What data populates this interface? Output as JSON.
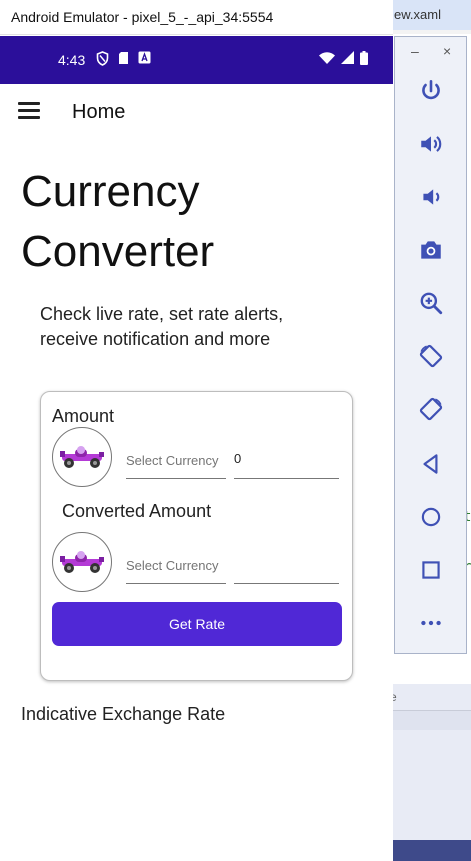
{
  "background": {
    "editor_tab_title": "ew.xaml",
    "lower_pane_char": "e"
  },
  "emulator": {
    "window_title": "Android Emulator - pixel_5_-_api_34:5554",
    "status_bar": {
      "time": "4:43"
    },
    "app_bar": {
      "title": "Home",
      "menu_icon": "hamburger-menu-icon"
    },
    "header": {
      "line1": "Currency",
      "line2": "Converter"
    },
    "subtitle": "Check live rate, set rate alerts, receive notification and more",
    "card": {
      "amount_label": "Amount",
      "from_currency_placeholder": "Select Currency",
      "amount_value": "0",
      "converted_label": "Converted Amount",
      "to_currency_placeholder": "Select Currency",
      "converted_value": "",
      "get_rate_label": "Get Rate"
    },
    "indicative_label": "Indicative Exchange Rate"
  },
  "toolbar": {
    "window_controls": {
      "minimize": "–",
      "close": "×"
    },
    "buttons": [
      "power-icon",
      "volume-up-icon",
      "volume-down-icon",
      "camera-icon",
      "zoom-icon",
      "rotate-left-icon",
      "rotate-right-icon",
      "back-icon",
      "home-icon",
      "overview-icon",
      "more-icon"
    ]
  },
  "colors": {
    "status_bar": "#2b0f9a",
    "accent_button": "#5028d6",
    "toolbar_icon": "#3f51b5"
  }
}
